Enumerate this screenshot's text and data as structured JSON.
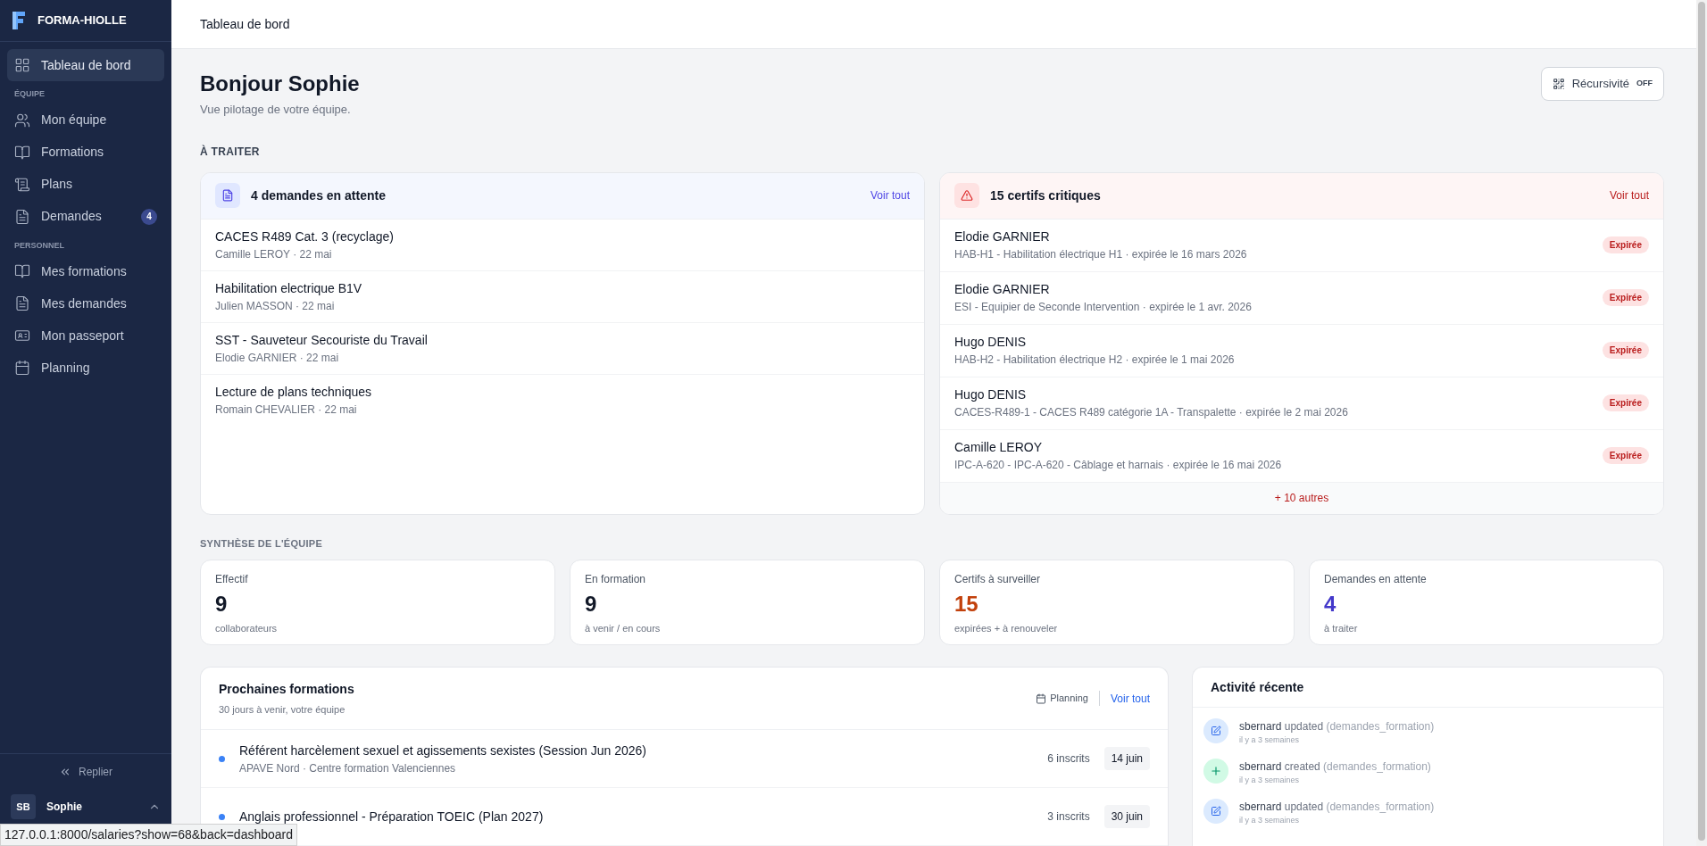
{
  "sidebar": {
    "brand": "FORMA-HIOLLE",
    "sections": [
      {
        "items": [
          {
            "label": "Tableau de bord",
            "selected": true
          }
        ]
      },
      {
        "heading": "ÉQUIPE",
        "items": [
          {
            "label": "Mon équipe",
            "selected": false
          },
          {
            "label": "Formations",
            "selected": false
          },
          {
            "label": "Plans",
            "selected": false
          },
          {
            "label": "Demandes",
            "selected": false,
            "badge": "4"
          }
        ]
      },
      {
        "heading": "PERSONNEL",
        "items": [
          {
            "label": "Mes formations",
            "selected": false
          },
          {
            "label": "Mes demandes",
            "selected": false
          },
          {
            "label": "Mon passeport",
            "selected": false
          },
          {
            "label": "Planning",
            "selected": false
          }
        ]
      }
    ],
    "collapse_label": "Replier",
    "user": {
      "initials": "SB",
      "name": "Sophie"
    }
  },
  "header": {
    "title": "Tableau de bord"
  },
  "greeting": {
    "title": "Bonjour Sophie",
    "subtitle": "Vue pilotage de votre équipe."
  },
  "toggle": {
    "label": "Récursivité",
    "state": "OFF"
  },
  "to_treat": {
    "heading": "À TRAITER",
    "requests": {
      "title": "4 demandes en attente",
      "link": "Voir tout",
      "rows": [
        {
          "title": "CACES R489 Cat. 3 (recyclage)",
          "meta": "Camille LEROY · 22 mai"
        },
        {
          "title": "Habilitation electrique B1V",
          "meta": "Julien MASSON · 22 mai"
        },
        {
          "title": "SST - Sauveteur Secouriste du Travail",
          "meta": "Elodie GARNIER · 22 mai"
        },
        {
          "title": "Lecture de plans techniques",
          "meta": "Romain CHEVALIER · 22 mai"
        }
      ]
    },
    "certs": {
      "title": "15 certifs critiques",
      "link": "Voir tout",
      "more": "+ 10 autres",
      "rows": [
        {
          "name": "Elodie GARNIER",
          "meta": "HAB-H1 - Habilitation électrique H1 · expirée le 16 mars 2026",
          "status": "Expirée"
        },
        {
          "name": "Elodie GARNIER",
          "meta": "ESI - Equipier de Seconde Intervention · expirée le 1 avr. 2026",
          "status": "Expirée"
        },
        {
          "name": "Hugo DENIS",
          "meta": "HAB-H2 - Habilitation électrique H2 · expirée le 1 mai 2026",
          "status": "Expirée"
        },
        {
          "name": "Hugo DENIS",
          "meta": "CACES-R489-1 - CACES R489 catégorie 1A - Transpalette · expirée le 2 mai 2026",
          "status": "Expirée"
        },
        {
          "name": "Camille LEROY",
          "meta": "IPC-A-620 - IPC-A-620 - Câblage et harnais · expirée le 16 mai 2026",
          "status": "Expirée"
        }
      ]
    }
  },
  "synthesis": {
    "heading": "SYNTHÈSE DE L'ÉQUIPE",
    "stats": [
      {
        "label": "Effectif",
        "value": "9",
        "sub": "collaborateurs",
        "color": "#111827"
      },
      {
        "label": "En formation",
        "value": "9",
        "sub": "à venir / en cours",
        "color": "#111827"
      },
      {
        "label": "Certifs à surveiller",
        "value": "15",
        "sub": "expirées + à renouveler",
        "color": "#c2410c"
      },
      {
        "label": "Demandes en attente",
        "value": "4",
        "sub": "à traiter",
        "color": "#4338ca"
      }
    ]
  },
  "upcoming": {
    "title": "Prochaines formations",
    "subtitle": "30 jours à venir, votre équipe",
    "planning": "Planning",
    "link": "Voir tout",
    "rows": [
      {
        "title": "Référent harcèlement sexuel et agissements sexistes (Session Jun 2026)",
        "meta": "APAVE Nord · Centre formation Valenciennes",
        "count": "6 inscrits",
        "date": "14 juin"
      },
      {
        "title": "Anglais professionnel - Préparation TOEIC (Plan 2027)",
        "count": "3 inscrits",
        "date": "30 juin"
      }
    ]
  },
  "activity": {
    "title": "Activité récente",
    "items": [
      {
        "kind": "update",
        "user": "sbernard",
        "action": "updated",
        "target": "(demandes_formation)",
        "time": "il y a 3 semaines"
      },
      {
        "kind": "create",
        "user": "sbernard",
        "action": "created",
        "target": "(demandes_formation)",
        "time": "il y a 3 semaines"
      },
      {
        "kind": "update",
        "user": "sbernard",
        "action": "updated",
        "target": "(demandes_formation)",
        "time": "il y a 3 semaines"
      }
    ]
  },
  "status_url": "127.0.0.1:8000/salaries?show=68&back=dashboard"
}
